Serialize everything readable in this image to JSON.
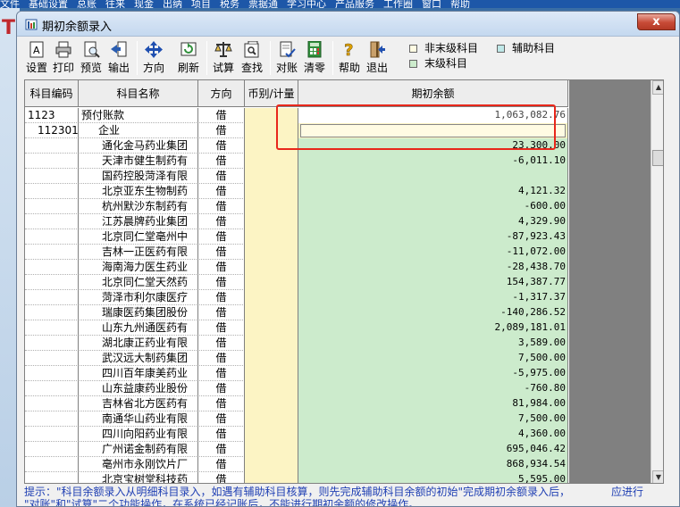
{
  "app_menu": [
    "文件",
    "基础设置",
    "总账",
    "往来",
    "现金",
    "出纳",
    "项目",
    "税务",
    "票据通",
    "学习中心",
    "产品服务",
    "工作圈",
    "窗口",
    "帮助"
  ],
  "background_app": {
    "logo_letter": "T"
  },
  "window": {
    "title": "期初余额录入",
    "close_label": "x"
  },
  "toolbar": {
    "buttons": [
      {
        "label": "设置",
        "icon": "settings-icon"
      },
      {
        "label": "打印",
        "icon": "printer-icon"
      },
      {
        "label": "预览",
        "icon": "preview-icon"
      },
      {
        "label": "输出",
        "icon": "export-icon"
      },
      {
        "label": "方向",
        "icon": "direction-icon"
      },
      {
        "label": "刷新",
        "icon": "refresh-icon"
      },
      {
        "label": "试算",
        "icon": "balance-scale-icon"
      },
      {
        "label": "查找",
        "icon": "find-icon"
      },
      {
        "label": "对账",
        "icon": "reconcile-icon"
      },
      {
        "label": "清零",
        "icon": "calculator-icon"
      },
      {
        "label": "帮助",
        "icon": "help-icon"
      },
      {
        "label": "退出",
        "icon": "exit-icon"
      }
    ]
  },
  "legend": {
    "non_leaf": {
      "label": "非末级科目",
      "color": "#fffbe3"
    },
    "auxiliary": {
      "label": "辅助科目",
      "color": "#bfe8e8"
    },
    "leaf": {
      "label": "末级科目",
      "color": "#ccebcc"
    }
  },
  "table": {
    "headers": {
      "code": "科目编码",
      "name": "科目名称",
      "direction": "方向",
      "currency": "币别/计量",
      "amount": "期初余额"
    },
    "rows": [
      {
        "code": "1123",
        "name": "预付账款",
        "direction": "借",
        "amount": "1,063,082.76"
      },
      {
        "code": "112301",
        "name": "企业",
        "direction": "借",
        "amount": ""
      },
      {
        "code": "",
        "name": "通化金马药业集团",
        "direction": "借",
        "amount": "23,300.00"
      },
      {
        "code": "",
        "name": "天津市健生制药有",
        "direction": "借",
        "amount": "-6,011.10"
      },
      {
        "code": "",
        "name": "国药控股菏泽有限",
        "direction": "借",
        "amount": ""
      },
      {
        "code": "",
        "name": "北京亚东生物制药",
        "direction": "借",
        "amount": "4,121.32"
      },
      {
        "code": "",
        "name": "杭州默沙东制药有",
        "direction": "借",
        "amount": "-600.00"
      },
      {
        "code": "",
        "name": "江苏晨牌药业集团",
        "direction": "借",
        "amount": "4,329.90"
      },
      {
        "code": "",
        "name": "北京同仁堂亳州中",
        "direction": "借",
        "amount": "-87,923.43"
      },
      {
        "code": "",
        "name": "吉林一正医药有限",
        "direction": "借",
        "amount": "-11,072.00"
      },
      {
        "code": "",
        "name": "海南海力医生药业",
        "direction": "借",
        "amount": "-28,438.70"
      },
      {
        "code": "",
        "name": "北京同仁堂天然药",
        "direction": "借",
        "amount": "154,387.77"
      },
      {
        "code": "",
        "name": "菏泽市利尔康医疗",
        "direction": "借",
        "amount": "-1,317.37"
      },
      {
        "code": "",
        "name": "瑞康医药集团股份",
        "direction": "借",
        "amount": "-140,286.52"
      },
      {
        "code": "",
        "name": "山东九州通医药有",
        "direction": "借",
        "amount": "2,089,181.01"
      },
      {
        "code": "",
        "name": "湖北康正药业有限",
        "direction": "借",
        "amount": "3,589.00"
      },
      {
        "code": "",
        "name": "武汉远大制药集团",
        "direction": "借",
        "amount": "7,500.00"
      },
      {
        "code": "",
        "name": "四川百年康美药业",
        "direction": "借",
        "amount": "-5,975.00"
      },
      {
        "code": "",
        "name": "山东益康药业股份",
        "direction": "借",
        "amount": "-760.80"
      },
      {
        "code": "",
        "name": "吉林省北方医药有",
        "direction": "借",
        "amount": "81,984.00"
      },
      {
        "code": "",
        "name": "南通华山药业有限",
        "direction": "借",
        "amount": "7,500.00"
      },
      {
        "code": "",
        "name": "四川向阳药业有限",
        "direction": "借",
        "amount": "4,360.00"
      },
      {
        "code": "",
        "name": "广州诺金制药有限",
        "direction": "借",
        "amount": "695,046.42"
      },
      {
        "code": "",
        "name": "亳州市永刚饮片厂",
        "direction": "借",
        "amount": "868,934.54"
      },
      {
        "code": "",
        "name": "北京宝树堂科技药",
        "direction": "借",
        "amount": "5,595.00"
      }
    ]
  },
  "hint": {
    "line1": "提示：\"科目余额录入从明细科目录入，如遇有辅助科目核算，则先完成辅助科目余额的初始\"完成期初余额录入后，",
    "line1b": "应进行",
    "line2": "\"对账\"和\"试算\"二个功能操作，在系统已经记账后，不能进行期初余额的修改操作。"
  }
}
